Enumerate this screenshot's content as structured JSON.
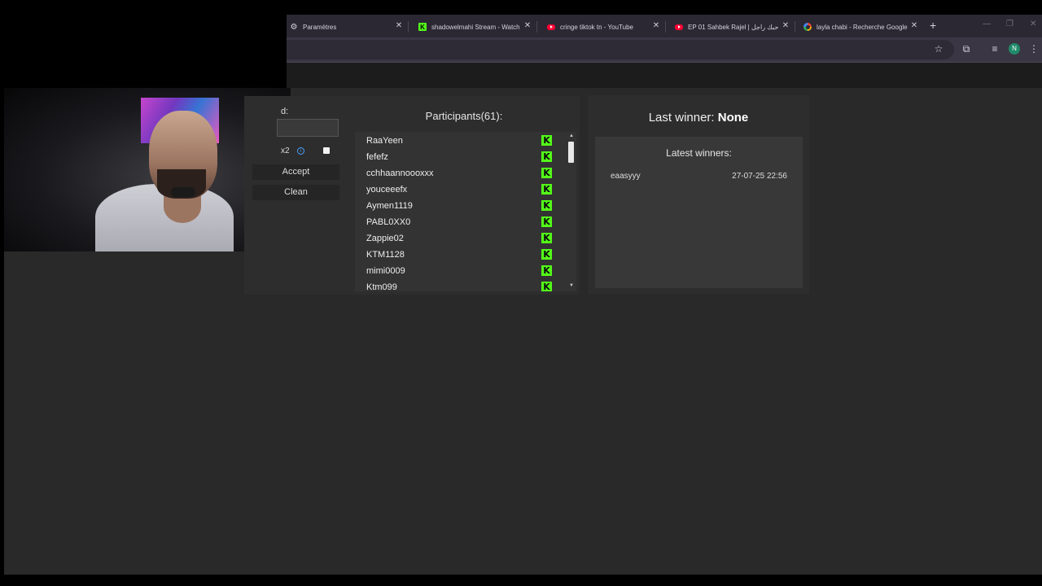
{
  "browser": {
    "tabs": [
      {
        "title": "Paramètres",
        "icon": "gear-icon"
      },
      {
        "title": "shadowelmahi Stream - Watch",
        "icon": "kick-icon"
      },
      {
        "title": "cringe tiktok tn - YouTube",
        "icon": "youtube-icon"
      },
      {
        "title": "EP 01 Sahbek Rajel | صاحبك راجل",
        "icon": "youtube-icon"
      },
      {
        "title": "layla chabi - Recherche Google",
        "icon": "google-icon"
      }
    ],
    "new_tab": "+",
    "profile_initial": "N"
  },
  "settings": {
    "command_label_partial": "d:",
    "option_label_partial": "x2",
    "accept_label": "Accept",
    "clean_label": "Clean"
  },
  "participants": {
    "title": "Participants(61):",
    "items": [
      {
        "name": "RaaYeen",
        "platform": "kick"
      },
      {
        "name": "fefefz",
        "platform": "kick"
      },
      {
        "name": "cchhaannoooxxx",
        "platform": "kick"
      },
      {
        "name": "youceeefx",
        "platform": "kick"
      },
      {
        "name": "Aymen1119",
        "platform": "kick"
      },
      {
        "name": "PABL0XX0",
        "platform": "kick"
      },
      {
        "name": "Zappie02",
        "platform": "kick"
      },
      {
        "name": "KTM1128",
        "platform": "kick"
      },
      {
        "name": "mimi0009",
        "platform": "kick"
      },
      {
        "name": "Ktm099",
        "platform": "kick"
      }
    ],
    "kick_glyph": "K"
  },
  "winners": {
    "last_winner_label": "Last winner:",
    "last_winner_value": "None",
    "latest_title": "Latest winners:",
    "latest": [
      {
        "name": "eaasyyy",
        "date": "27-07-25 22:56"
      }
    ]
  },
  "colors": {
    "kick_green": "#53fc18",
    "panel_bg": "#2d2d2d",
    "page_bg": "#292929"
  }
}
